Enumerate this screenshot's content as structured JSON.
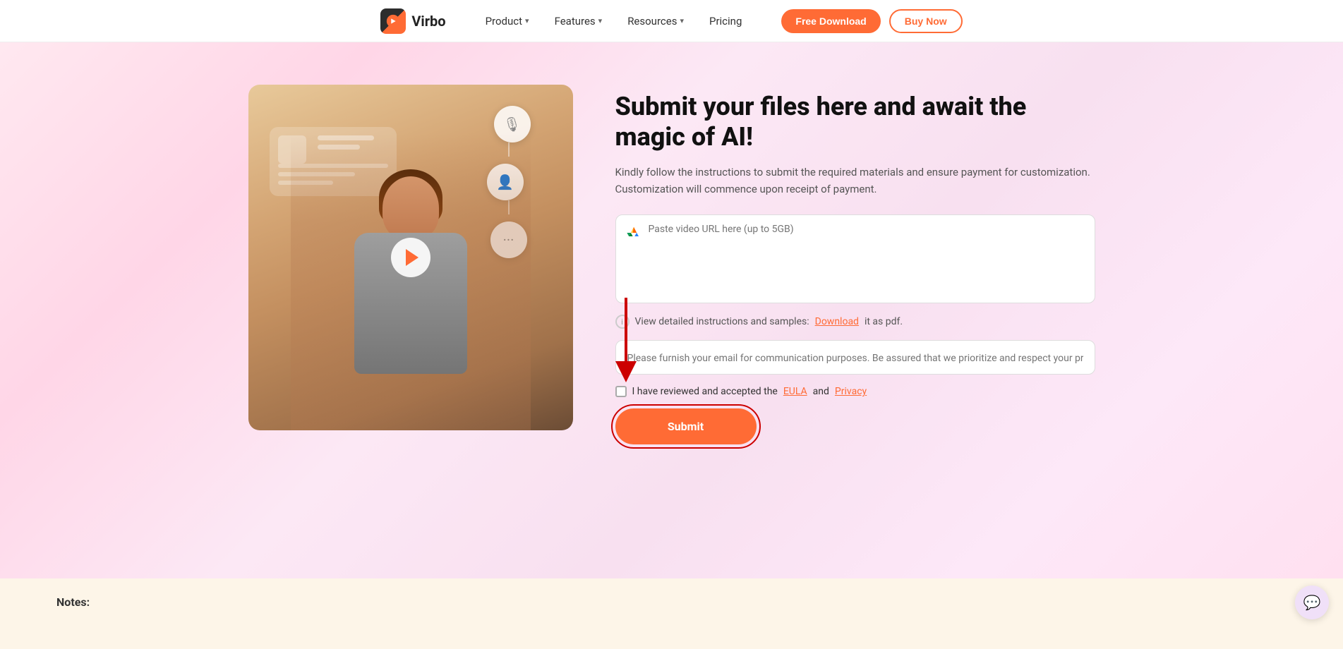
{
  "navbar": {
    "logo_text": "Virbo",
    "nav_items": [
      {
        "label": "Product",
        "has_dropdown": true
      },
      {
        "label": "Features",
        "has_dropdown": true
      },
      {
        "label": "Resources",
        "has_dropdown": true
      },
      {
        "label": "Pricing",
        "has_dropdown": false
      }
    ],
    "btn_free_download": "Free Download",
    "btn_buy_now": "Buy Now"
  },
  "main": {
    "title": "Submit your files here and await the magic of AI!",
    "subtitle": "Kindly follow the instructions to submit the required materials and ensure payment for customization. Customization will commence upon receipt of payment.",
    "video_url_placeholder": "Paste video URL here (up to 5GB)",
    "instructions_text": "View detailed instructions and samples: ",
    "download_link_text": "Download",
    "instructions_suffix": " it as pdf.",
    "email_placeholder": "Please furnish your email for communication purposes. Be assured that we prioritize and respect your privacy.",
    "eula_text_before": "I have reviewed and accepted the ",
    "eula_link": "EULA",
    "eula_and": " and ",
    "privacy_link": "Privacy",
    "submit_btn": "Submit"
  },
  "notes": {
    "label": "Notes:"
  },
  "icons": {
    "gdrive": "google-drive-icon",
    "info": "info-icon",
    "mic": "🎙",
    "user": "👤",
    "dots": "···"
  }
}
